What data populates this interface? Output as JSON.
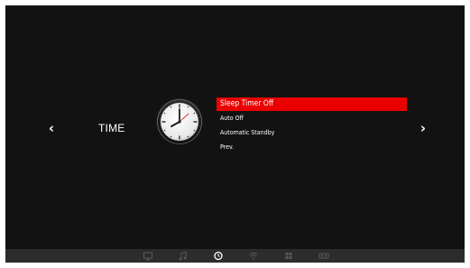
{
  "category": {
    "title": "TIME"
  },
  "menu": {
    "items": [
      {
        "label": "Sleep Timer Off",
        "selected": true
      },
      {
        "label": "Auto Off",
        "selected": false
      },
      {
        "label": "Automatic Standby",
        "selected": false
      },
      {
        "label": "Prev.",
        "selected": false
      }
    ]
  },
  "navigation": {
    "left_arrow": "‹",
    "right_arrow": "›"
  },
  "bottom_bar": {
    "icons": [
      "tv-icon",
      "music-icon",
      "clock-icon",
      "wifi-icon",
      "apps-icon",
      "input-source-icon"
    ],
    "active_icon": "clock-icon"
  },
  "colors": {
    "background": "#121212",
    "selection": "#ea0000",
    "bottom_bar": "#2c2c2c",
    "icon_inactive": "#5a5a5a",
    "icon_active": "#ffffff"
  }
}
